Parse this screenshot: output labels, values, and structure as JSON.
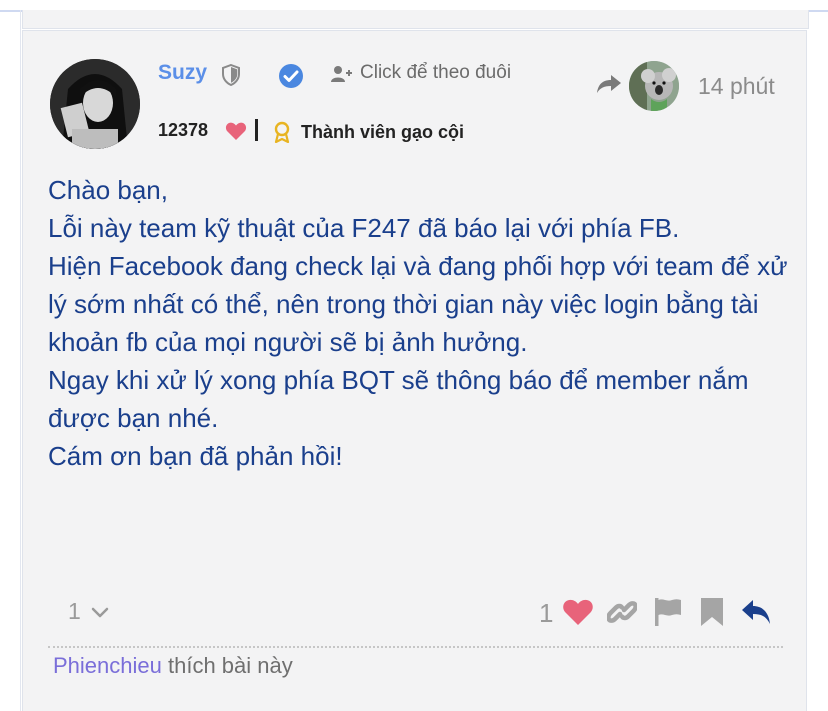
{
  "post": {
    "username": "Suzy",
    "follow_label": "Click để theo đuôi",
    "time": "14 phút",
    "score": "12378",
    "rank": "Thành viên gạo cội",
    "body": "Chào bạn,\nLỗi này team kỹ thuật của F247 đã báo lại với phía FB.\nHiện Facebook đang check lại và đang phối hợp với team để xử lý sớm nhất có thể, nên trong thời gian này việc login bằng tài khoản fb của mọi người sẽ bị ảnh hưởng.\nNgay khi xử lý xong phía BQT sẽ thông báo để member nắm được bạn nhé.\nCám ơn bạn đã phản hồi!",
    "reply_count": "1",
    "like_count": "1",
    "liked_by_user": "Phienchieu",
    "liked_by_suffix": " thích bài này"
  },
  "icons": {
    "shield": "shield-icon",
    "verified": "verified-icon",
    "follow": "add-user-icon",
    "reply_to": "share-arrow-icon",
    "heart": "heart-icon",
    "badge": "medal-icon",
    "link": "link-icon",
    "flag": "flag-icon",
    "bookmark": "bookmark-icon",
    "reply": "reply-icon"
  },
  "colors": {
    "username": "#5b8fe8",
    "body_text": "#1a3f8c",
    "heart": "#e8637a",
    "verified": "#4a87e0",
    "badge": "#e8b422",
    "liked_user": "#7a6ed9"
  }
}
